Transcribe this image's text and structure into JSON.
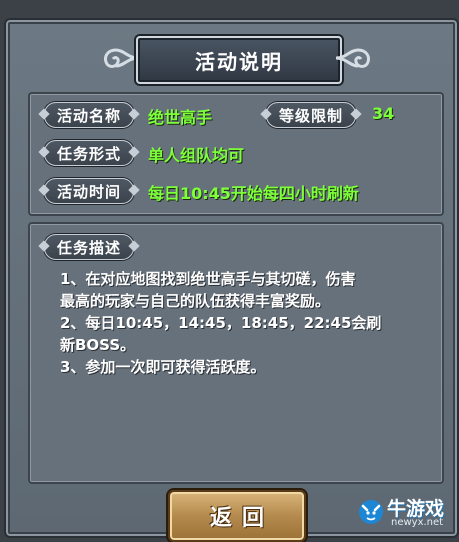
{
  "dialog": {
    "title": "活动说明"
  },
  "info": {
    "activity_name_label": "活动名称",
    "activity_name_value": "绝世高手",
    "level_limit_label": "等级限制",
    "level_limit_value": "34",
    "task_form_label": "任务形式",
    "task_form_value": "单人组队均可",
    "activity_time_label": "活动时间",
    "activity_time_value": "每日10:45开始每四小时刷新"
  },
  "description": {
    "label": "任务描述",
    "lines": [
      "1、在对应地图找到绝世高手与其切磋，伤害",
      "最高的玩家与自己的队伍获得丰富奖励。",
      "2、每日10:45，14:45，18:45，22:45会刷",
      "新BOSS。",
      "3、参加一次即可获得活跃度。"
    ]
  },
  "buttons": {
    "back_label": "返回"
  },
  "watermark": {
    "text": "牛游戏",
    "url": "newyx.net"
  },
  "colors": {
    "value_green": "#7dff3a",
    "panel": "#66717c",
    "button_gold": "#c49a5c"
  }
}
